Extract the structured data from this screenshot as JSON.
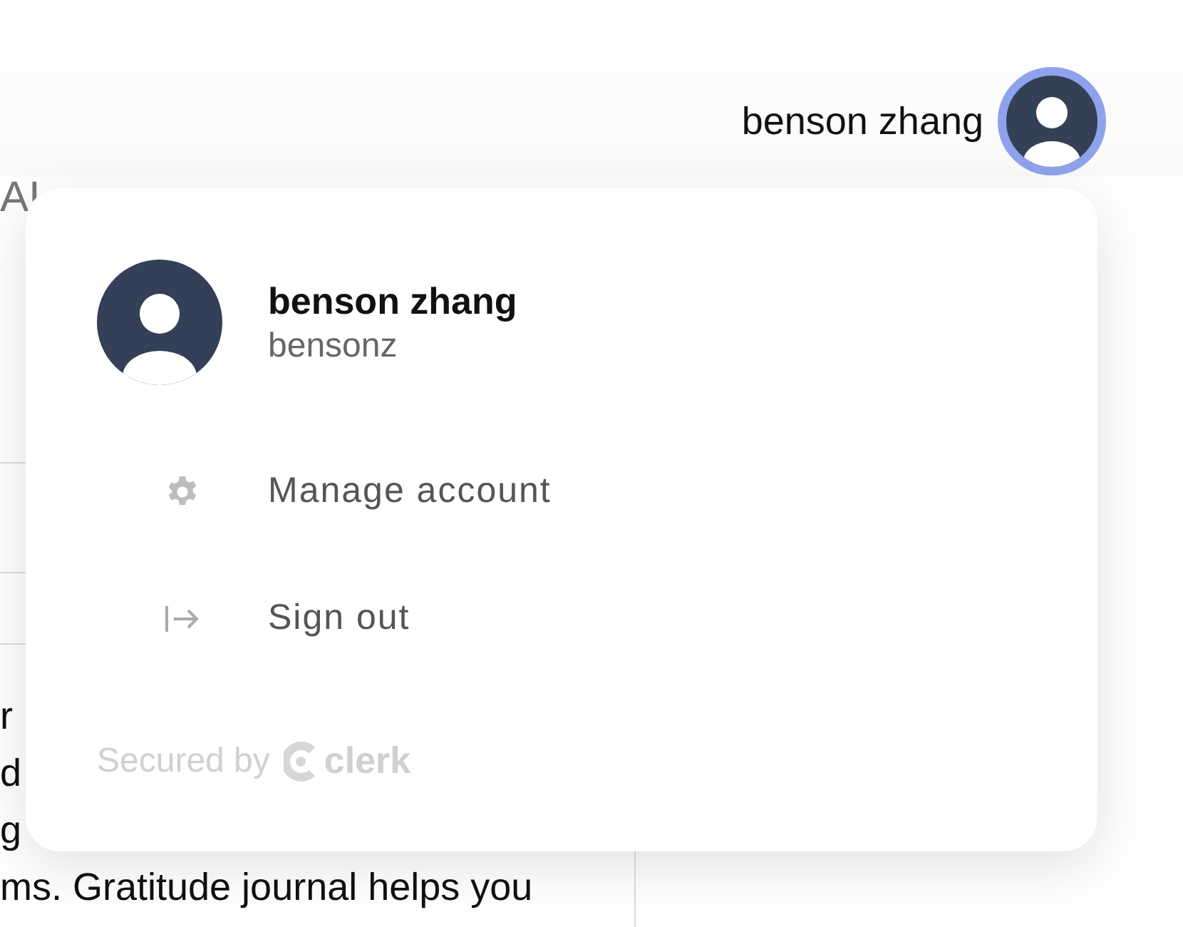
{
  "header": {
    "user_name": "benson zhang"
  },
  "background": {
    "heading": "AI",
    "text_lines": [
      "r",
      "d",
      "g",
      "ms. Gratitude journal helps you"
    ]
  },
  "menu": {
    "user_name": "benson zhang",
    "username": "bensonz",
    "items": [
      {
        "kind": "settings",
        "label": "Manage account"
      },
      {
        "kind": "sign_out",
        "label": "Sign out"
      }
    ],
    "footer": {
      "prefix": "Secured by",
      "brand": "clerk"
    }
  }
}
